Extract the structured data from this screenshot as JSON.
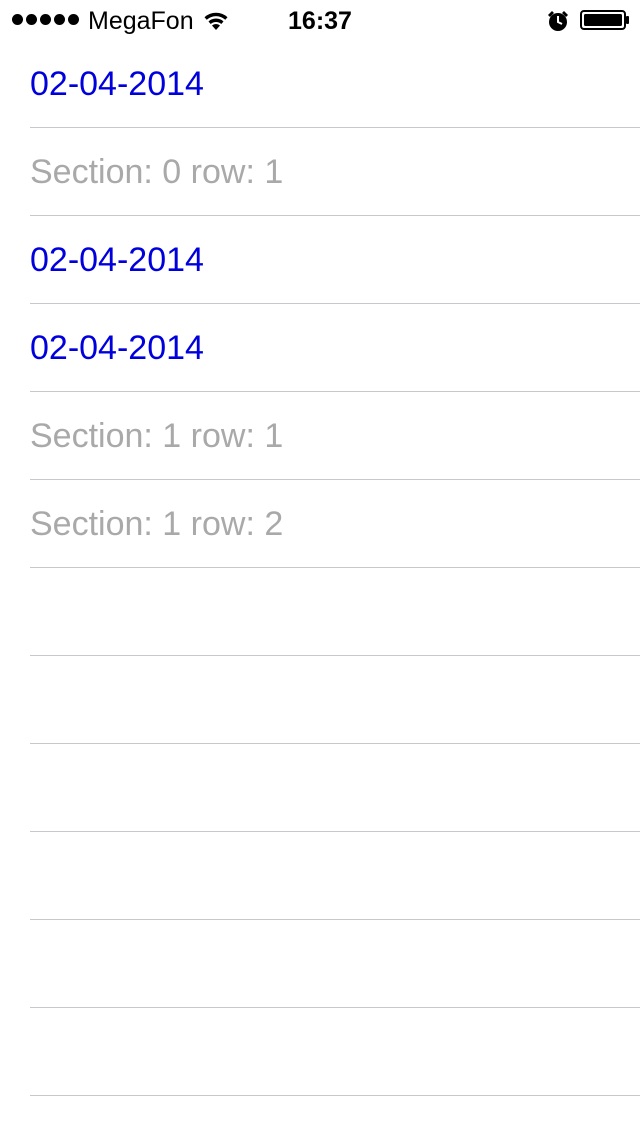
{
  "status_bar": {
    "carrier": "MegaFon",
    "time": "16:37",
    "signal_bars": 5,
    "icons": [
      "wifi-icon",
      "alarm-icon",
      "battery-icon"
    ]
  },
  "colors": {
    "date_text": "#0000dd",
    "placeholder_text": "#a9a9a9",
    "separator": "#c8c7cc"
  },
  "table": {
    "rows": [
      {
        "label": "02-04-2014",
        "kind": "date"
      },
      {
        "label": "Section: 0 row: 1",
        "kind": "placeholder"
      },
      {
        "label": "02-04-2014",
        "kind": "date"
      },
      {
        "label": "02-04-2014",
        "kind": "date"
      },
      {
        "label": "Section: 1 row: 1",
        "kind": "placeholder"
      },
      {
        "label": "Section: 1 row: 2",
        "kind": "placeholder"
      },
      {
        "label": "",
        "kind": "empty"
      },
      {
        "label": "",
        "kind": "empty"
      },
      {
        "label": "",
        "kind": "empty"
      },
      {
        "label": "",
        "kind": "empty"
      },
      {
        "label": "",
        "kind": "empty"
      },
      {
        "label": "",
        "kind": "empty"
      }
    ]
  }
}
